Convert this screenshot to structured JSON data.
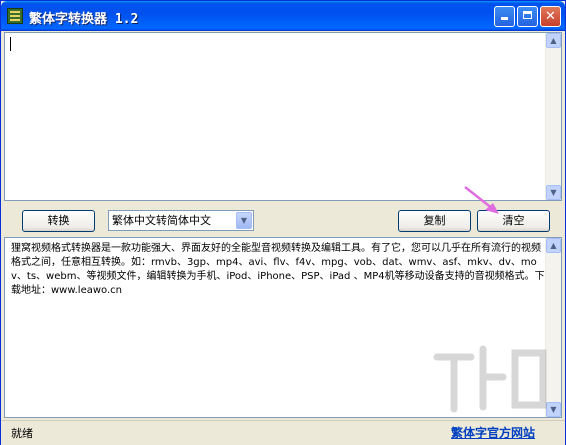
{
  "window": {
    "title": "繁体字转换器 1.2",
    "icons": {
      "app": "app-book-icon",
      "minimize": "minimize-icon",
      "maximize": "maximize-icon",
      "close": "close-icon"
    }
  },
  "toolbar": {
    "convert_label": "转换",
    "mode_value": "繁体中文转简体中文",
    "copy_label": "复制",
    "clear_label": "清空"
  },
  "output_text": "狸窝视频格式转换器是一款功能强大、界面友好的全能型音视频转换及编辑工具。有了它，您可以几乎在所有流行的视频格式之间，任意相互转换。如：rmvb、3gp、mp4、avi、flv、f4v、mpg、vob、dat、wmv、asf、mkv、dv、mov、ts、webm、等视频文件，编辑转换为手机、iPod、iPhone、PSP、iPad 、MP4机等移动设备支持的音视频格式。下载地址：www.leawo.cn",
  "status": {
    "text": "就绪",
    "link": "繁体字官方网站"
  },
  "colors": {
    "accent_arrow": "#e06ee0",
    "link": "#0040c0"
  }
}
